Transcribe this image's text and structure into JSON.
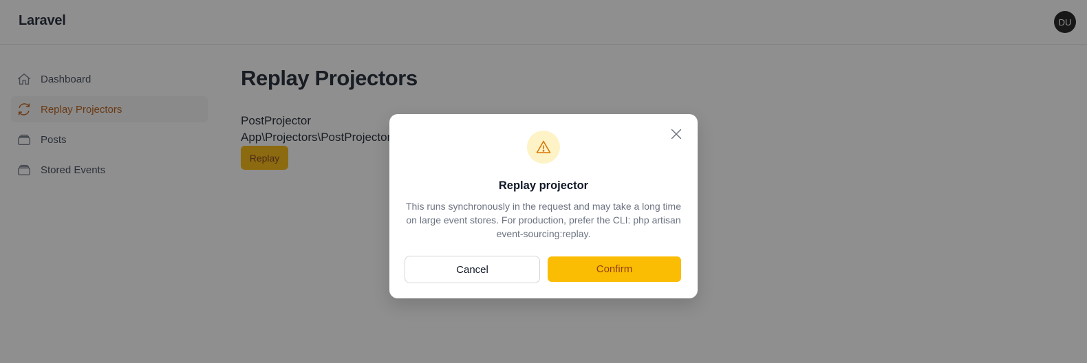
{
  "header": {
    "brand": "Laravel",
    "avatar_initials": "DU"
  },
  "sidebar": {
    "items": [
      {
        "label": "Dashboard",
        "icon": "home-icon",
        "active": false
      },
      {
        "label": "Replay Projectors",
        "icon": "refresh-icon",
        "active": true
      },
      {
        "label": "Posts",
        "icon": "stack-icon",
        "active": false
      },
      {
        "label": "Stored Events",
        "icon": "stack-icon",
        "active": false
      }
    ]
  },
  "main": {
    "title": "Replay Projectors",
    "projectors": [
      {
        "name": "PostProjector",
        "class": "App\\Projectors\\PostProjector",
        "button_label": "Replay"
      }
    ]
  },
  "modal": {
    "title": "Replay projector",
    "body": "This runs synchronously in the request and may take a long time on large event stores. For production, prefer the CLI: php artisan event-sourcing:replay.",
    "cancel_label": "Cancel",
    "confirm_label": "Confirm",
    "icon": "warning-icon",
    "close_icon": "close-icon"
  },
  "colors": {
    "accent": "#fbbc04",
    "active_nav_text": "#b45309",
    "warning_bg": "#fef3c7",
    "warning_icon": "#d97706",
    "overlay": "rgba(31,31,31,0.5)"
  }
}
